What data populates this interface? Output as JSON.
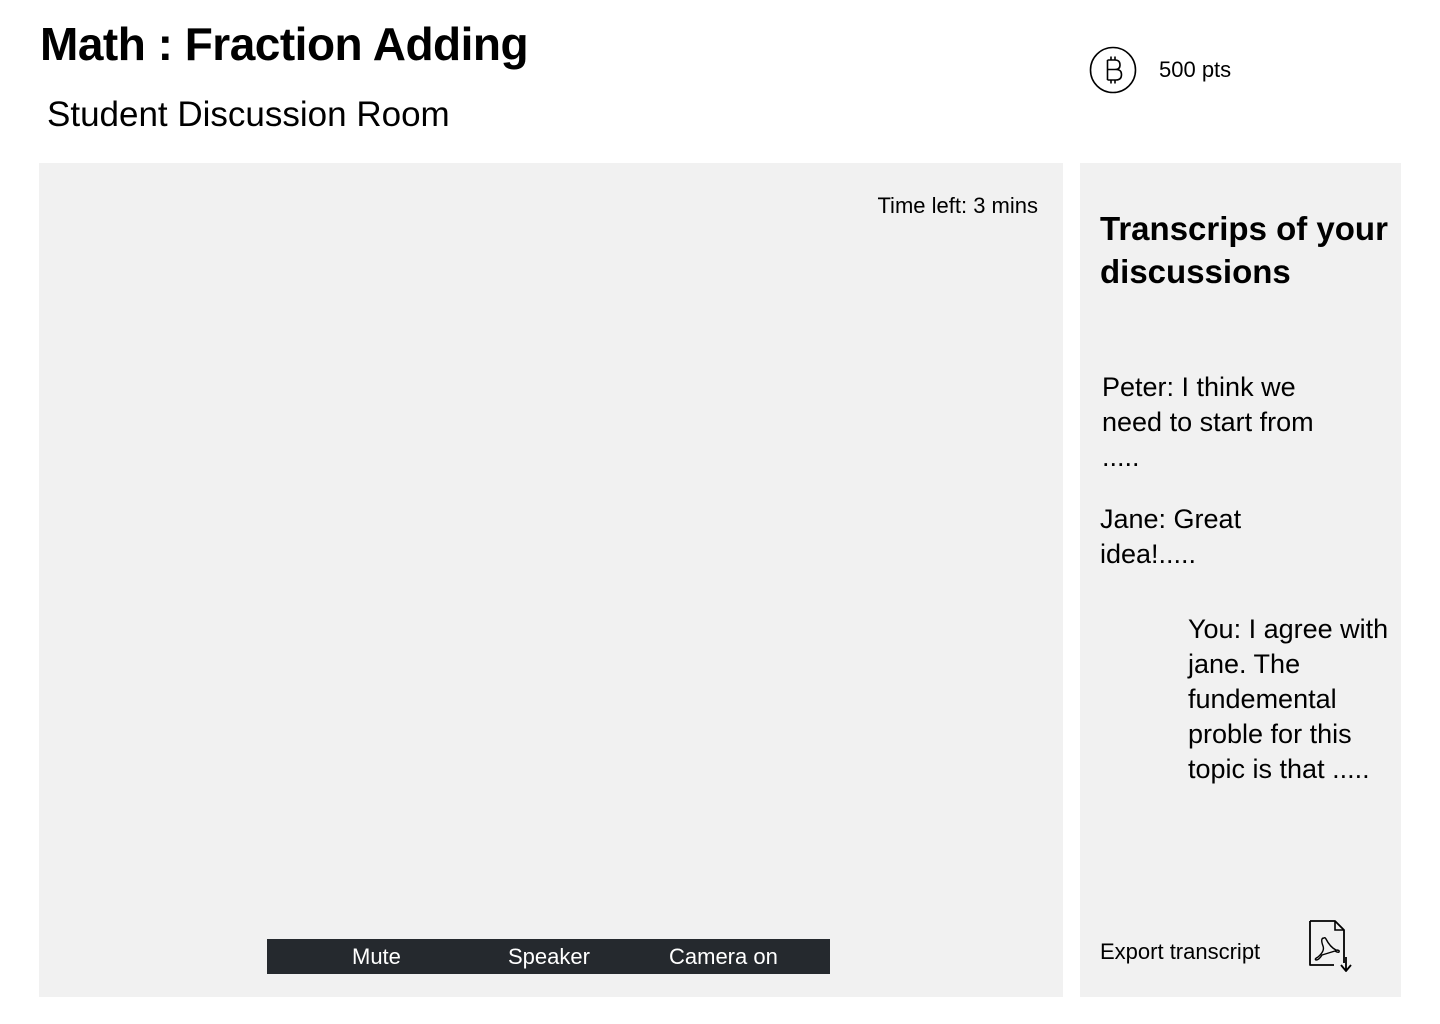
{
  "header": {
    "title": "Math : Fraction Adding",
    "subtitle": "Student Discussion Room",
    "points": "500 pts",
    "points_icon": "bitcoin-coin-icon"
  },
  "video": {
    "time_left": "Time left: 3 mins",
    "controls": {
      "mute_label": "Mute",
      "speaker_label": "Speaker",
      "camera_label": "Camera on",
      "bar_color": "#25292e"
    }
  },
  "transcript": {
    "title": "Transcrips of your discussions",
    "messages": [
      {
        "text": "Peter: I think we need to start from ....."
      },
      {
        "text": "Jane: Great idea!....."
      },
      {
        "text": "You: I agree with jane. The fundemental proble for this topic is that ....."
      }
    ],
    "export_label": "Export transcript",
    "export_icon": "pdf-download-icon"
  },
  "colors": {
    "panel_background": "#f1f1f1",
    "text": "#000000",
    "control_text": "#ffffff"
  }
}
